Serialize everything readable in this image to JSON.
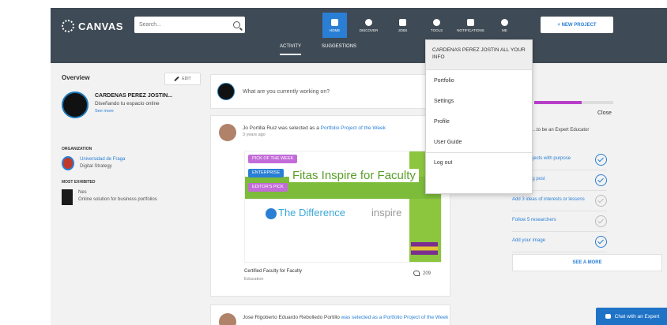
{
  "app": {
    "name": "CANVAS"
  },
  "search": {
    "placeholder": "Search..."
  },
  "nav": {
    "items": [
      {
        "label": "Home",
        "icon": "home-icon"
      },
      {
        "label": "Discover",
        "icon": "compass-icon"
      },
      {
        "label": "Jobs",
        "icon": "briefcase-icon"
      },
      {
        "label": "Tools",
        "icon": "wrench-icon"
      },
      {
        "label": "Notifications",
        "icon": "bell-icon"
      },
      {
        "label": "Me",
        "icon": "avatar-icon"
      }
    ],
    "new_project": "+ NEW PROJECT"
  },
  "subtabs": [
    {
      "label": "ACTIVITY"
    },
    {
      "label": "SUGGESTIONS"
    }
  ],
  "left": {
    "title": "Overview",
    "edit": "EDIT",
    "profile_name": "CARDENAS PEREZ JOSTIN...",
    "profile_tagline": "Diseñando tu espacio online",
    "profile_more": "See more",
    "org_heading": "Organization",
    "org_name": "Universidad de Fraga",
    "org_sub": "Digital Strategy",
    "exh_heading": "Most Exhibited",
    "exh_name": "Nes",
    "exh_desc": "Online solution for business portfolios"
  },
  "composer": {
    "prompt": "What are you currently working on?"
  },
  "post": {
    "activity_prefix": "Jo Portilla Ruiz was selected as a ",
    "activity_link": "Portfolio Project of the Week",
    "time": "3 years ago",
    "badges": [
      "PICK OF THE WEEK",
      "ENTERPRISE",
      "EDITOR'S PICK"
    ],
    "image_heading": "Fitas Inspire for Faculty",
    "image_diff": "The Difference",
    "image_inspire": "inspire",
    "caption_title": "Certified Faculty for Faculty",
    "caption_sub": "Education",
    "likes": "209"
  },
  "post2": {
    "activity_prefix": "Jose Rigoberto Eduardo Rebolledo Portillo ",
    "activity_link": "was selected as a Portfolio Project of the Week"
  },
  "right": {
    "progress_label": "Close",
    "progress_fraction": 0.6,
    "heading": "...to be an Expert Educator",
    "tasks": [
      {
        "label": "Add 3 projects with purpose",
        "done": true
      },
      {
        "label": "Add a blog post",
        "done": true
      },
      {
        "label": "Add 3 ideas of interests or lessons",
        "done": false
      },
      {
        "label": "Follow 5 researchers",
        "done": false
      },
      {
        "label": "Add your image",
        "done": true
      }
    ],
    "see_more": "SEE A MORE"
  },
  "dropdown": {
    "header": "CARDENAS PEREZ JOSTIN ALL YOUR INFO",
    "items": [
      "Portfolio",
      "Settings",
      "Profile",
      "User Guide"
    ],
    "logout": "Log out"
  },
  "chat": {
    "label": "Chat with an Expert"
  },
  "colors": {
    "topbar": "#3e4a55",
    "accent": "#2a7fd5",
    "progress": "#b83fc9"
  }
}
